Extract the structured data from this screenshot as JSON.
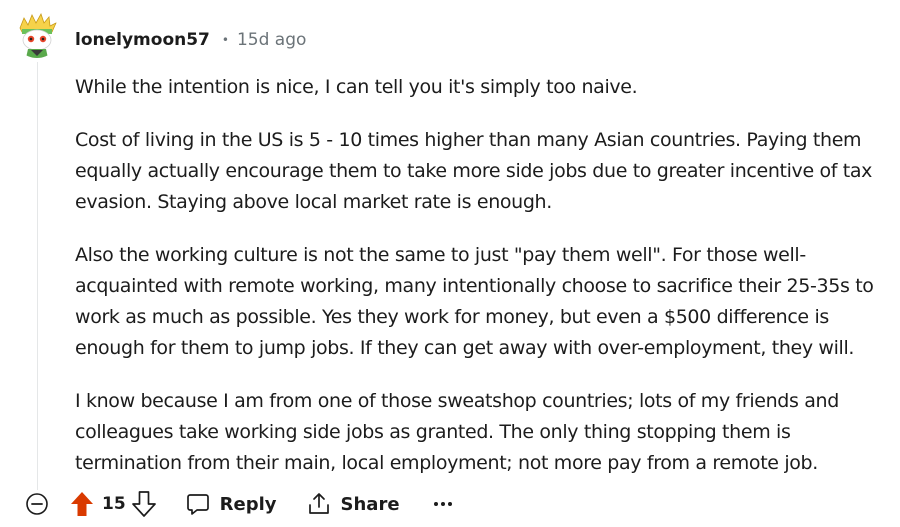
{
  "comment": {
    "author": "lonelymoon57",
    "separator": "•",
    "timestamp": "15d ago",
    "paragraphs": [
      "While the intention is nice, I can tell you it's simply too naive.",
      "Cost of living in the US is 5 - 10 times higher than many Asian countries. Paying them equally actually encourage them to take more side jobs due to greater incentive of tax evasion. Staying above local market rate is enough.",
      "Also the working culture is not the same to just \"pay them well\". For those well-acquainted with remote working, many intentionally choose to sacrifice their 25-35s to work as much as possible. Yes they work for money, but even a $500 difference is enough for them to jump jobs. If they can get away with over-employment, they will.",
      "I know because I am from one of those sweatshop countries; lots of my friends and colleagues take working side jobs as granted. The only thing stopping them is termination from their main, local employment; not more pay from a remote job."
    ]
  },
  "actions": {
    "vote_count": "15",
    "reply_label": "Reply",
    "share_label": "Share",
    "more_label": "•••"
  },
  "icons": {
    "collapse": "collapse-minus-icon",
    "upvote": "upvote-arrow-icon",
    "downvote": "downvote-arrow-icon",
    "reply": "speech-bubble-icon",
    "share": "share-upload-icon",
    "more": "ellipsis-icon"
  },
  "colors": {
    "upvote_active": "#d93a00",
    "text_primary": "#1c1c1c",
    "text_muted": "#6b7378",
    "thread_line": "#e5e7e8"
  }
}
